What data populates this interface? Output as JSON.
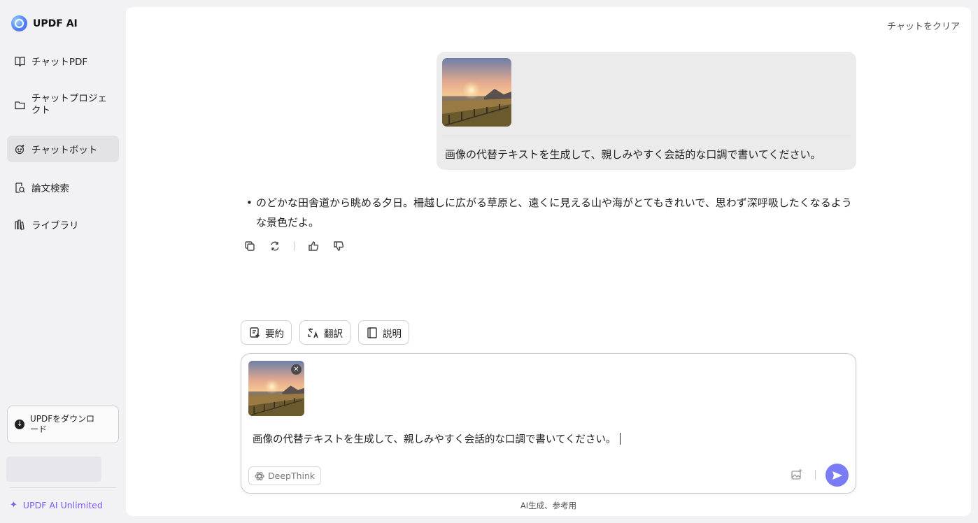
{
  "app": {
    "name": "UPDF AI"
  },
  "sidebar": {
    "items": [
      {
        "label": "チャットPDF",
        "icon": "book-icon"
      },
      {
        "label": "チャットプロジェクト",
        "icon": "folder-icon"
      },
      {
        "label": "チャットボット",
        "icon": "bot-icon",
        "active": true
      },
      {
        "label": "論文検索",
        "icon": "search-doc-icon"
      },
      {
        "label": "ライブラリ",
        "icon": "library-icon"
      }
    ],
    "download_label": "UPDFをダウンロード",
    "unlimited_label": "UPDF AI Unlimited"
  },
  "header": {
    "clear_label": "チャットをクリア"
  },
  "chat": {
    "user_message": "画像の代替テキストを生成して、親しみやすく会話的な口調で書いてください。",
    "ai_answer": "のどかな田舎道から眺める夕日。柵越しに広がる草原と、遠くに見える山や海がとてもきれいで、思わず深呼吸したくなるような景色だよ。"
  },
  "quick_actions": [
    {
      "label": "要約",
      "icon": "summary-icon"
    },
    {
      "label": "翻訳",
      "icon": "translate-icon"
    },
    {
      "label": "説明",
      "icon": "explain-icon"
    }
  ],
  "composer": {
    "text": "画像の代替テキストを生成して、親しみやすく会話的な口調で書いてください。",
    "deepthink_label": "DeepThink"
  },
  "footer_note": "AI生成、参考用",
  "colors": {
    "accent": "#7a7cf5",
    "brand": "#7c5cf2"
  }
}
